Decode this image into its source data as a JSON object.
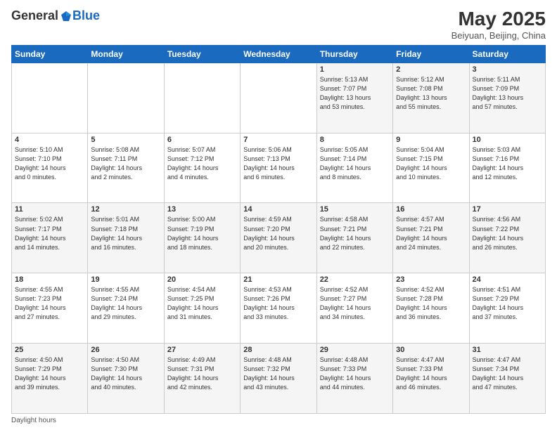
{
  "header": {
    "logo_general": "General",
    "logo_blue": "Blue",
    "month_title": "May 2025",
    "location": "Beiyuan, Beijing, China"
  },
  "days_of_week": [
    "Sunday",
    "Monday",
    "Tuesday",
    "Wednesday",
    "Thursday",
    "Friday",
    "Saturday"
  ],
  "weeks": [
    [
      {
        "day": "",
        "info": ""
      },
      {
        "day": "",
        "info": ""
      },
      {
        "day": "",
        "info": ""
      },
      {
        "day": "",
        "info": ""
      },
      {
        "day": "1",
        "info": "Sunrise: 5:13 AM\nSunset: 7:07 PM\nDaylight: 13 hours\nand 53 minutes."
      },
      {
        "day": "2",
        "info": "Sunrise: 5:12 AM\nSunset: 7:08 PM\nDaylight: 13 hours\nand 55 minutes."
      },
      {
        "day": "3",
        "info": "Sunrise: 5:11 AM\nSunset: 7:09 PM\nDaylight: 13 hours\nand 57 minutes."
      }
    ],
    [
      {
        "day": "4",
        "info": "Sunrise: 5:10 AM\nSunset: 7:10 PM\nDaylight: 14 hours\nand 0 minutes."
      },
      {
        "day": "5",
        "info": "Sunrise: 5:08 AM\nSunset: 7:11 PM\nDaylight: 14 hours\nand 2 minutes."
      },
      {
        "day": "6",
        "info": "Sunrise: 5:07 AM\nSunset: 7:12 PM\nDaylight: 14 hours\nand 4 minutes."
      },
      {
        "day": "7",
        "info": "Sunrise: 5:06 AM\nSunset: 7:13 PM\nDaylight: 14 hours\nand 6 minutes."
      },
      {
        "day": "8",
        "info": "Sunrise: 5:05 AM\nSunset: 7:14 PM\nDaylight: 14 hours\nand 8 minutes."
      },
      {
        "day": "9",
        "info": "Sunrise: 5:04 AM\nSunset: 7:15 PM\nDaylight: 14 hours\nand 10 minutes."
      },
      {
        "day": "10",
        "info": "Sunrise: 5:03 AM\nSunset: 7:16 PM\nDaylight: 14 hours\nand 12 minutes."
      }
    ],
    [
      {
        "day": "11",
        "info": "Sunrise: 5:02 AM\nSunset: 7:17 PM\nDaylight: 14 hours\nand 14 minutes."
      },
      {
        "day": "12",
        "info": "Sunrise: 5:01 AM\nSunset: 7:18 PM\nDaylight: 14 hours\nand 16 minutes."
      },
      {
        "day": "13",
        "info": "Sunrise: 5:00 AM\nSunset: 7:19 PM\nDaylight: 14 hours\nand 18 minutes."
      },
      {
        "day": "14",
        "info": "Sunrise: 4:59 AM\nSunset: 7:20 PM\nDaylight: 14 hours\nand 20 minutes."
      },
      {
        "day": "15",
        "info": "Sunrise: 4:58 AM\nSunset: 7:21 PM\nDaylight: 14 hours\nand 22 minutes."
      },
      {
        "day": "16",
        "info": "Sunrise: 4:57 AM\nSunset: 7:21 PM\nDaylight: 14 hours\nand 24 minutes."
      },
      {
        "day": "17",
        "info": "Sunrise: 4:56 AM\nSunset: 7:22 PM\nDaylight: 14 hours\nand 26 minutes."
      }
    ],
    [
      {
        "day": "18",
        "info": "Sunrise: 4:55 AM\nSunset: 7:23 PM\nDaylight: 14 hours\nand 27 minutes."
      },
      {
        "day": "19",
        "info": "Sunrise: 4:55 AM\nSunset: 7:24 PM\nDaylight: 14 hours\nand 29 minutes."
      },
      {
        "day": "20",
        "info": "Sunrise: 4:54 AM\nSunset: 7:25 PM\nDaylight: 14 hours\nand 31 minutes."
      },
      {
        "day": "21",
        "info": "Sunrise: 4:53 AM\nSunset: 7:26 PM\nDaylight: 14 hours\nand 33 minutes."
      },
      {
        "day": "22",
        "info": "Sunrise: 4:52 AM\nSunset: 7:27 PM\nDaylight: 14 hours\nand 34 minutes."
      },
      {
        "day": "23",
        "info": "Sunrise: 4:52 AM\nSunset: 7:28 PM\nDaylight: 14 hours\nand 36 minutes."
      },
      {
        "day": "24",
        "info": "Sunrise: 4:51 AM\nSunset: 7:29 PM\nDaylight: 14 hours\nand 37 minutes."
      }
    ],
    [
      {
        "day": "25",
        "info": "Sunrise: 4:50 AM\nSunset: 7:29 PM\nDaylight: 14 hours\nand 39 minutes."
      },
      {
        "day": "26",
        "info": "Sunrise: 4:50 AM\nSunset: 7:30 PM\nDaylight: 14 hours\nand 40 minutes."
      },
      {
        "day": "27",
        "info": "Sunrise: 4:49 AM\nSunset: 7:31 PM\nDaylight: 14 hours\nand 42 minutes."
      },
      {
        "day": "28",
        "info": "Sunrise: 4:48 AM\nSunset: 7:32 PM\nDaylight: 14 hours\nand 43 minutes."
      },
      {
        "day": "29",
        "info": "Sunrise: 4:48 AM\nSunset: 7:33 PM\nDaylight: 14 hours\nand 44 minutes."
      },
      {
        "day": "30",
        "info": "Sunrise: 4:47 AM\nSunset: 7:33 PM\nDaylight: 14 hours\nand 46 minutes."
      },
      {
        "day": "31",
        "info": "Sunrise: 4:47 AM\nSunset: 7:34 PM\nDaylight: 14 hours\nand 47 minutes."
      }
    ]
  ],
  "footer": {
    "daylight_label": "Daylight hours"
  }
}
